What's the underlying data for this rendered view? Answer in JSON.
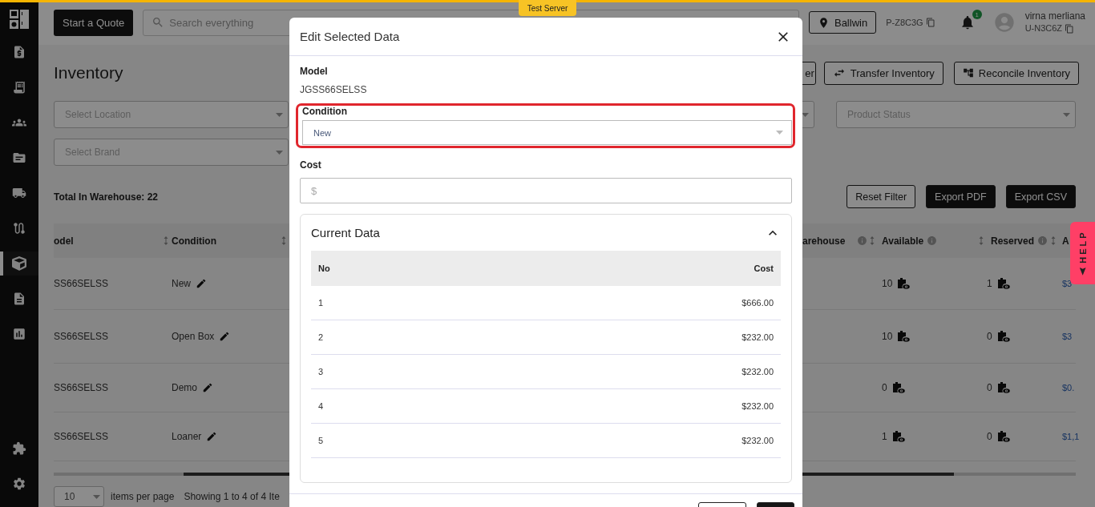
{
  "test_server_badge": "Test Server",
  "sidebar": {
    "items": [
      {
        "selected": false
      },
      {
        "selected": false
      },
      {
        "selected": false
      },
      {
        "selected": false
      },
      {
        "selected": false
      },
      {
        "selected": false
      },
      {
        "selected": true
      },
      {
        "selected": false
      },
      {
        "selected": false
      },
      {
        "selected": false
      },
      {
        "selected": false
      }
    ]
  },
  "header": {
    "quote_button": "Start a Quote",
    "search": {
      "placeholder": "Search everything"
    },
    "location": "Ballwin",
    "company_code": "P-Z8C3G",
    "notifications": "1",
    "user": {
      "name": "virna merliana",
      "code": "U-N3C6Z"
    }
  },
  "page": {
    "title": "Inventory",
    "actions": [
      "er",
      "Transfer Inventory",
      "Reconcile Inventory"
    ],
    "filters": [
      {
        "placeholder": "Select Location"
      },
      {
        "placeholder": "Product Status"
      },
      {
        "placeholder": "Select Brand"
      }
    ],
    "total": "Total In Warehouse: 22",
    "buttons": [
      "Reset Filter",
      "Export PDF",
      "Export CSV"
    ]
  },
  "table": {
    "columns": [
      "odel",
      "Condition",
      "arehouse",
      "Available",
      "Reserved",
      "A"
    ],
    "rows": [
      {
        "model": "SS66SELSS",
        "condition": "New",
        "available": "10",
        "reserved": "1",
        "column_7": "$3"
      },
      {
        "model": "SS66SELSS",
        "condition": "Open Box",
        "available": "10",
        "reserved": "0",
        "column_7": "$3"
      },
      {
        "model": "SS66SELSS",
        "condition": "Demo",
        "available": "0",
        "reserved": "0",
        "column_7": "$0."
      },
      {
        "model": "SS66SELSS",
        "condition": "Loaner",
        "available": "1",
        "reserved": "0",
        "column_7": "$1,1"
      }
    ]
  },
  "pagination": {
    "page_size": "10",
    "per_page_label": "items per page",
    "summary": "Showing 1 to 4 of 4 Ite"
  },
  "help_tab": "HELP",
  "modal": {
    "title": "Edit Selected Data",
    "model_label": "Model",
    "model_value": "JGSS66SELSS",
    "condition": {
      "label": "Condition",
      "value": "New",
      "highlighted": true
    },
    "cost": {
      "label": "Cost",
      "placeholder": "$"
    },
    "current_data": {
      "title": "Current Data",
      "expanded": true,
      "columns": [
        "No",
        "Cost"
      ],
      "rows": [
        [
          "1",
          "$666.00"
        ],
        [
          "2",
          "$232.00"
        ],
        [
          "3",
          "$232.00"
        ],
        [
          "4",
          "$232.00"
        ],
        [
          "5",
          "$232.00"
        ]
      ]
    }
  }
}
